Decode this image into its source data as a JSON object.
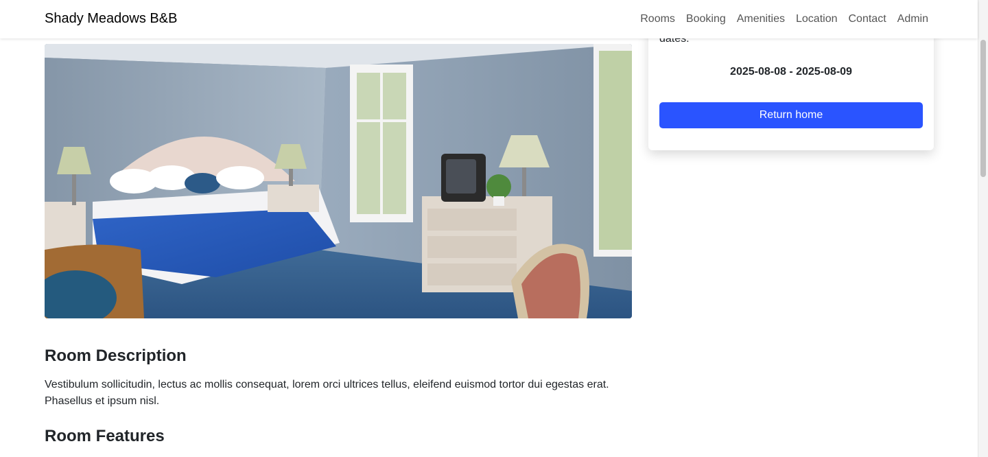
{
  "navbar": {
    "brand": "Shady Meadows B&B",
    "links": [
      "Rooms",
      "Booking",
      "Amenities",
      "Location",
      "Contact",
      "Admin"
    ]
  },
  "room_image": {
    "alt": "Room photo"
  },
  "booking_card": {
    "intro": "dates:",
    "dates": "2025-08-08 - 2025-08-09",
    "button_label": "Return home"
  },
  "content": {
    "description_heading": "Room Description",
    "description_text": "Vestibulum sollicitudin, lectus ac mollis consequat, lorem orci ultrices tellus, eleifend euismod tortor dui egestas erat. Phasellus et ipsum nisl.",
    "features_heading": "Room Features"
  },
  "colors": {
    "primary_button": "#2a54ff",
    "text": "#212529",
    "nav_link": "#555555"
  }
}
